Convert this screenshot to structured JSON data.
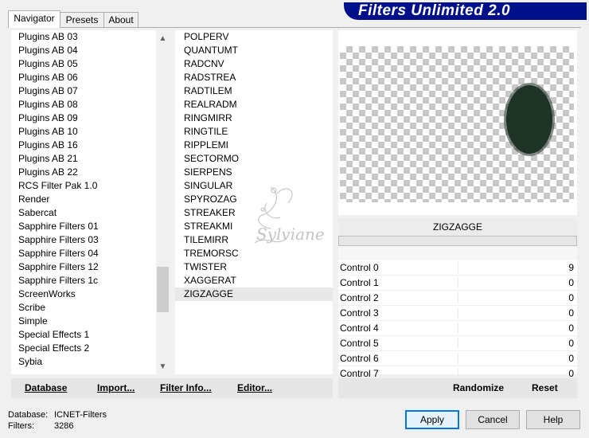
{
  "tabs": [
    {
      "label": "Navigator",
      "active": true
    },
    {
      "label": "Presets",
      "active": false
    },
    {
      "label": "About",
      "active": false
    }
  ],
  "banner": {
    "title": "Filters Unlimited 2.0",
    "color": "#00108a"
  },
  "categories": [
    "Plugins AB 03",
    "Plugins AB 04",
    "Plugins AB 05",
    "Plugins AB 06",
    "Plugins AB 07",
    "Plugins AB 08",
    "Plugins AB 09",
    "Plugins AB 10",
    "Plugins AB 16",
    "Plugins AB 21",
    "Plugins AB 22",
    "RCS Filter Pak 1.0",
    "Render",
    "Sabercat",
    "Sapphire Filters 01",
    "Sapphire Filters 03",
    "Sapphire Filters 04",
    "Sapphire Filters 12",
    "Sapphire Filters 1c",
    "ScreenWorks",
    "Scribe",
    "Simple",
    "Special Effects 1",
    "Special Effects 2",
    "Sybia"
  ],
  "filters": [
    "POLPERV",
    "QUANTUMT",
    "RADCNV",
    "RADSTREA",
    "RADTILEM",
    "REALRADM",
    "RINGMIRR",
    "RINGTILE",
    "RIPPLEMI",
    "SECTORMO",
    "SIERPENS",
    "SINGULAR",
    "SPYROZAG",
    "STREAKER",
    "STREAKMI",
    "TILEMIRR",
    "TREMORSC",
    "TWISTER",
    "XAGGERAT",
    "ZIGZAGGE"
  ],
  "selected_filter": "ZIGZAGGE",
  "preview": {
    "filter_name": "ZIGZAGGE",
    "blob_color": "#1f3326"
  },
  "controls": [
    {
      "label": "Control 0",
      "value": "9"
    },
    {
      "label": "Control 1",
      "value": "0"
    },
    {
      "label": "Control 2",
      "value": "0"
    },
    {
      "label": "Control 3",
      "value": "0"
    },
    {
      "label": "Control 4",
      "value": "0"
    },
    {
      "label": "Control 5",
      "value": "0"
    },
    {
      "label": "Control 6",
      "value": "0"
    },
    {
      "label": "Control 7",
      "value": "0"
    }
  ],
  "left_buttons": {
    "database": "Database",
    "import": "Import...",
    "filter_info": "Filter Info...",
    "editor": "Editor..."
  },
  "right_buttons": {
    "randomize": "Randomize",
    "reset": "Reset"
  },
  "status": {
    "database_label": "Database:",
    "database_value": "ICNET-Filters",
    "filters_label": "Filters:",
    "filters_value": "3286"
  },
  "dialog_buttons": {
    "apply": "Apply",
    "cancel": "Cancel",
    "help": "Help"
  },
  "watermark": {
    "text": "Sylviane"
  },
  "accent_color": "#0078d7"
}
